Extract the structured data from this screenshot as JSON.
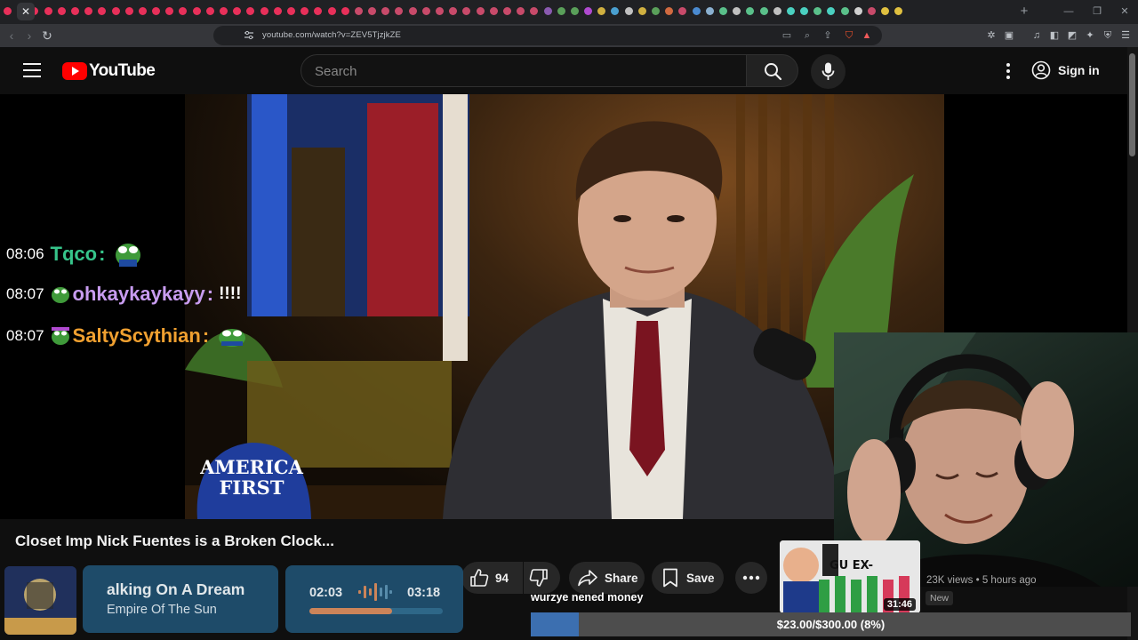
{
  "browser": {
    "url": "youtube.com/watch?v=ZEV5TjzjkZE",
    "tab_count": 75,
    "tab_colors": [
      "#e8305a",
      "#e8305a",
      "#e8305a",
      "#e8305a",
      "#e8305a",
      "#e8305a",
      "#e8305a",
      "#e8305a",
      "#e8305a",
      "#e8305a",
      "#e8305a",
      "#e8305a",
      "#e8305a",
      "#e8305a",
      "#e8305a",
      "#e8305a",
      "#e8305a",
      "#e8305a",
      "#e8305a",
      "#e8305a",
      "#e8305a",
      "#e8305a",
      "#e8305a",
      "#e8305a",
      "#e8305a",
      "#e8305a",
      "#c84a6a",
      "#c84a6a",
      "#c84a6a",
      "#c84a6a",
      "#c84a6a",
      "#c84a6a",
      "#c84a6a",
      "#c84a6a",
      "#c84a6a",
      "#c84a6a",
      "#c84a6a",
      "#c84a6a",
      "#c84a6a",
      "#c84a6a",
      "#8a5ab0",
      "#5aa05a",
      "#5aa05a",
      "#b04ad0",
      "#d0b040",
      "#4aa0d0",
      "#c0c0c0",
      "#d0b040",
      "#5aa05a",
      "#d06a40",
      "#c84a6a",
      "#4a8ad0",
      "#8ab0d0",
      "#5ac08a",
      "#c0c0c0",
      "#5ac08a",
      "#5ac08a",
      "#c0c0c0",
      "#4ad0c0",
      "#4ad0c0",
      "#5ac08a",
      "#4ad0c0",
      "#5ac08a",
      "#d0d0d0",
      "#c84a6a",
      "#e0c040",
      "#e0c040"
    ],
    "window_controls": [
      "—",
      "❐",
      "✕"
    ]
  },
  "header": {
    "logo_text": "YouTube",
    "search_placeholder": "Search",
    "sign_in": "Sign in"
  },
  "chat": [
    {
      "time": "08:06",
      "user": "Tqco",
      "sep": ":",
      "message": "",
      "color": "#36c48a"
    },
    {
      "time": "08:07",
      "user": "ohkaykaykayy",
      "sep": ":",
      "message": "!!!!",
      "color": "#c89cf0"
    },
    {
      "time": "08:07",
      "user": "SaltyScythian",
      "sep": ":",
      "message": "",
      "color": "#f0a030"
    }
  ],
  "video": {
    "hat_text_line1": "AMERICA",
    "hat_text_line2": "FIRST",
    "title": "Closet Imp Nick Fuentes is a Broken Clock..."
  },
  "actions": {
    "like_count": "94",
    "share": "Share",
    "save": "Save"
  },
  "recommended": {
    "duration": "31:46",
    "meta": "23K views • 5 hours ago",
    "badge": "New",
    "thumb_text": "GU EX-"
  },
  "now_playing": {
    "song": "alking On A Dream",
    "artist": "Empire Of The Sun",
    "elapsed": "02:03",
    "total": "03:18",
    "progress": 0.62
  },
  "ticker": "wurzye nened money",
  "goal": {
    "text": "$23.00/$300.00 (8%)",
    "progress": 0.08
  }
}
